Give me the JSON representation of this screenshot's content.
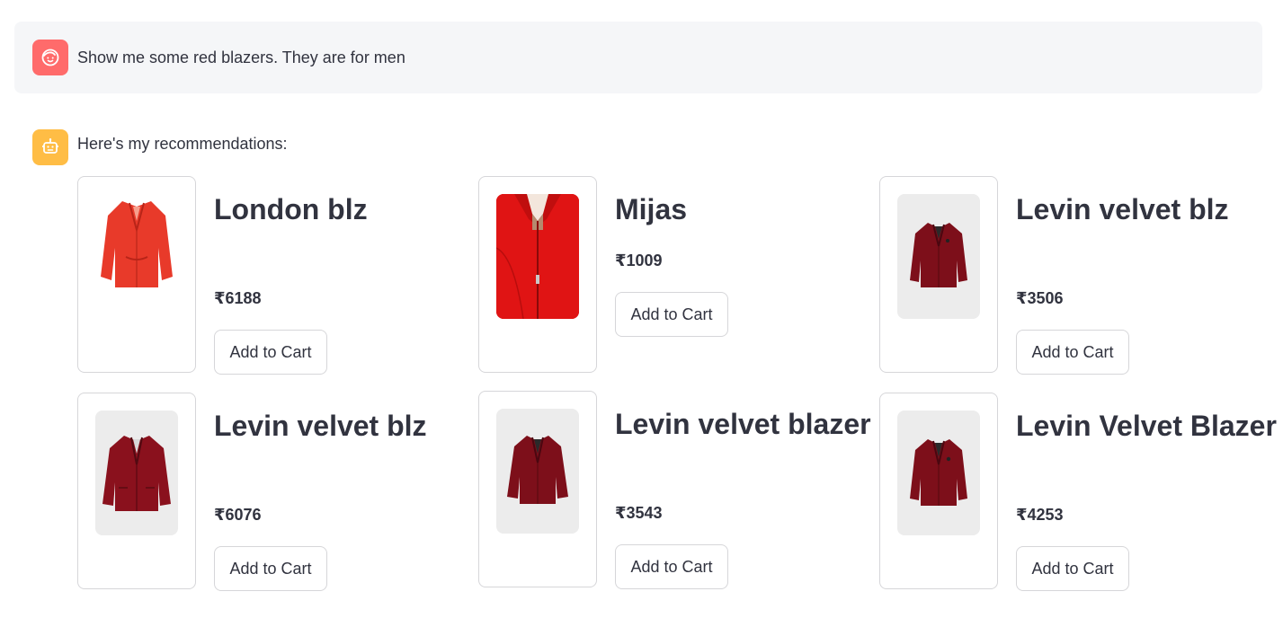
{
  "conversation": {
    "user_message": "Show me some red blazers. They are for men",
    "user_avatar_icon": "user-face-icon",
    "bot_avatar_icon": "robot-icon",
    "bot_message": "Here's my recommendations:",
    "colors": {
      "user_avatar": "#ff6b6b",
      "bot_avatar": "#ffbd45",
      "user_bubble": "#f5f6f8"
    }
  },
  "products": [
    {
      "name": "London blz",
      "price": "₹6188",
      "button": "Add to Cart",
      "image": "red-blazer-photo"
    },
    {
      "name": "Mijas",
      "price": "₹1009",
      "button": "Add to Cart",
      "image": "red-jacket-closeup-photo"
    },
    {
      "name": "Levin velvet blz",
      "price": "₹3506",
      "button": "Add to Cart",
      "image": "velvet-blazer-photo"
    },
    {
      "name": "Levin velvet blz",
      "price": "₹6076",
      "button": "Add to Cart",
      "image": "velvet-blazer-photo"
    },
    {
      "name": "Levin velvet blazer",
      "price": "₹3543",
      "button": "Add to Cart",
      "image": "velvet-blazer-photo"
    },
    {
      "name": "Levin Velvet Blazer",
      "price": "₹4253",
      "button": "Add to Cart",
      "image": "velvet-blazer-photo"
    }
  ]
}
